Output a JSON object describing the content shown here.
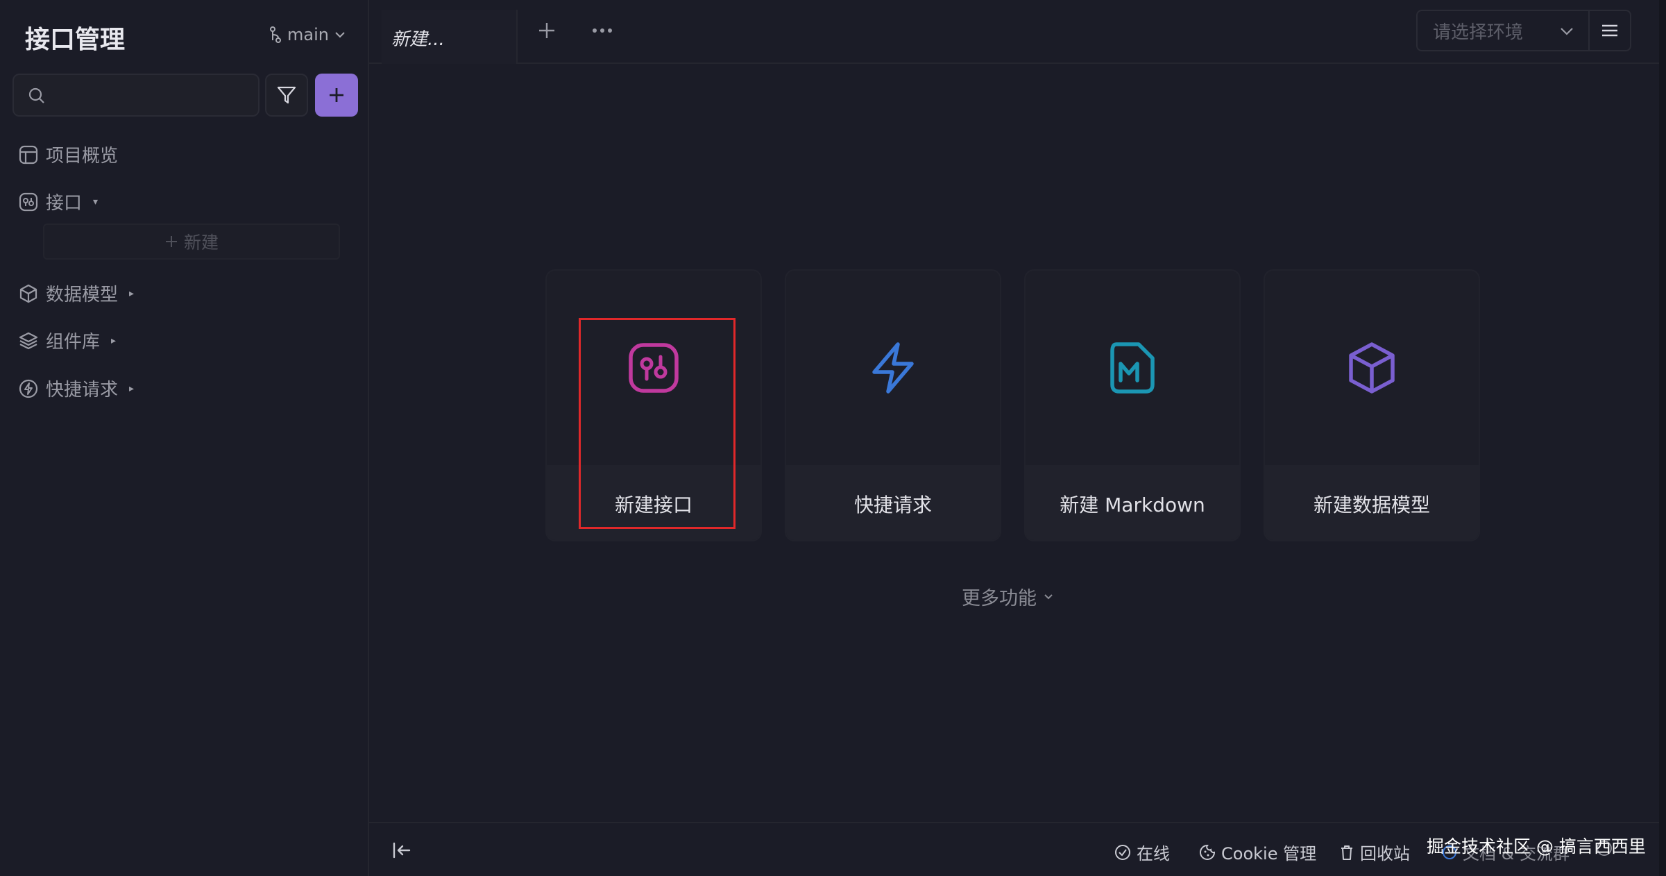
{
  "sidebar": {
    "title": "接口管理",
    "branch": "main",
    "search": {
      "placeholder": ""
    },
    "items": [
      {
        "label": "项目概览",
        "icon": "layout-icon"
      },
      {
        "label": "接口",
        "icon": "api-icon",
        "caret": "▾"
      },
      {
        "label": "数据模型",
        "icon": "cube-icon",
        "caret": "▸"
      },
      {
        "label": "组件库",
        "icon": "layers-icon",
        "caret": "▸"
      },
      {
        "label": "快捷请求",
        "icon": "bolt-icon",
        "caret": "▸"
      }
    ],
    "new_label": "新建"
  },
  "tabs": {
    "active_tab": "新建..."
  },
  "env": {
    "placeholder": "请选择环境"
  },
  "cards": [
    {
      "label": "新建接口",
      "icon": "api-icon",
      "color": "#c0399e"
    },
    {
      "label": "快捷请求",
      "icon": "bolt-icon",
      "color": "#3a78d8"
    },
    {
      "label": "新建 Markdown",
      "icon": "markdown-icon",
      "color": "#1b96b3"
    },
    {
      "label": "新建数据模型",
      "icon": "cube-icon",
      "color": "#7a5fd0"
    }
  ],
  "more_features": "更多功能",
  "footer": {
    "online": "在线",
    "cookie": "Cookie 管理",
    "recycle": "回收站",
    "docs": "文档 & 交流群",
    "watermark": "掘金技术社区 @ 搞言西西里"
  },
  "colors": {
    "accent": "#8b6fd6",
    "highlight": "#e0282a"
  }
}
